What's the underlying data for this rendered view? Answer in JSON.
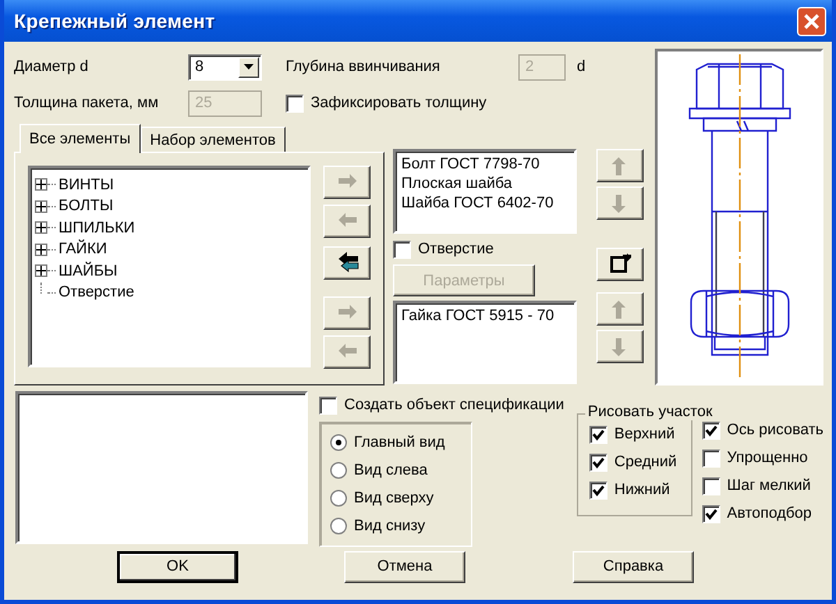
{
  "window": {
    "title": "Крепежный элемент"
  },
  "diameter": {
    "label": "Диаметр d",
    "value": "8"
  },
  "depth": {
    "label": "Глубина ввинчивания",
    "value": "2",
    "unit": "d",
    "disabled": true
  },
  "thickness": {
    "label": "Толщина пакета, мм",
    "value": "25",
    "disabled": true
  },
  "fix_thickness": {
    "label": "Зафиксировать толщину",
    "checked": false
  },
  "tabs": [
    {
      "label": "Все элементы",
      "selected": true
    },
    {
      "label": "Набор элементов",
      "selected": false
    }
  ],
  "tree": [
    {
      "label": "ВИНТЫ",
      "expandable": true
    },
    {
      "label": "БОЛТЫ",
      "expandable": true
    },
    {
      "label": "ШПИЛЬКИ",
      "expandable": true
    },
    {
      "label": "ГАЙКИ",
      "expandable": true
    },
    {
      "label": "ШАЙБЫ",
      "expandable": true
    },
    {
      "label": "Отверстие",
      "expandable": false
    }
  ],
  "transfer_buttons": [
    {
      "kind": "right",
      "disabled": true
    },
    {
      "kind": "left",
      "disabled": true
    },
    {
      "kind": "back-all",
      "disabled": false
    },
    {
      "kind": "right",
      "disabled": true
    },
    {
      "kind": "left",
      "disabled": true
    }
  ],
  "upper_list": {
    "items": [
      "Болт ГОСТ 7798-70",
      "Плоская шайба",
      "Шайба ГОСТ 6402-70"
    ]
  },
  "hole": {
    "label": "Отверстие",
    "checked": false
  },
  "params_button": {
    "label": "Параметры",
    "disabled": true
  },
  "lower_list": {
    "items": [
      "Гайка ГОСТ 5915 - 70"
    ]
  },
  "order_buttons": [
    {
      "kind": "up",
      "disabled": true
    },
    {
      "kind": "down",
      "disabled": true
    },
    {
      "kind": "flip",
      "disabled": false
    },
    {
      "kind": "up",
      "disabled": true
    },
    {
      "kind": "down",
      "disabled": true
    }
  ],
  "spec": {
    "label": "Создать объект спецификации",
    "checked": false
  },
  "views": [
    {
      "label": "Главный вид",
      "selected": true
    },
    {
      "label": "Вид слева",
      "selected": false
    },
    {
      "label": "Вид сверху",
      "selected": false
    },
    {
      "label": "Вид снизу",
      "selected": false
    }
  ],
  "draw_section": {
    "title": "Рисовать участок",
    "options": [
      {
        "label": "Верхний",
        "checked": true
      },
      {
        "label": "Средний",
        "checked": true
      },
      {
        "label": "Нижний",
        "checked": true
      }
    ]
  },
  "options": [
    {
      "label": "Ось рисовать",
      "checked": true
    },
    {
      "label": "Упрощенно",
      "checked": false
    },
    {
      "label": "Шаг мелкий",
      "checked": false
    },
    {
      "label": "Автоподбор",
      "checked": true
    }
  ],
  "buttons": [
    {
      "label": "OK",
      "default": true
    },
    {
      "label": "Отмена",
      "default": false
    },
    {
      "label": "Справка",
      "default": false
    }
  ]
}
